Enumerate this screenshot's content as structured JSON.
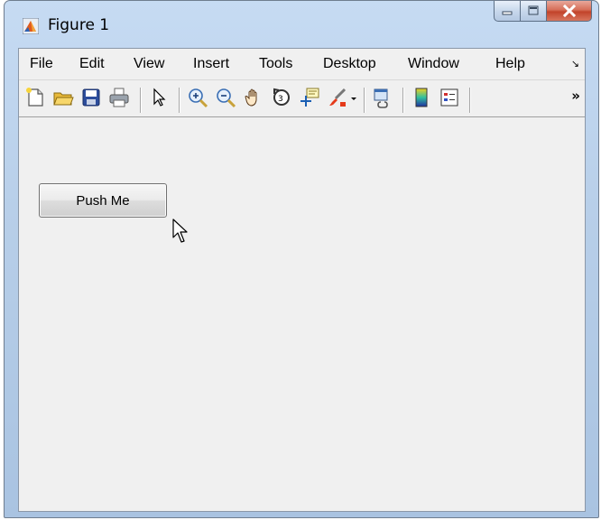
{
  "window": {
    "title": "Figure 1",
    "caption_buttons": [
      "minimize",
      "maximize",
      "close"
    ]
  },
  "menubar": {
    "items": [
      "File",
      "Edit",
      "View",
      "Insert",
      "Tools",
      "Desktop",
      "Window",
      "Help"
    ],
    "overflow_glyph": "↘"
  },
  "toolbar": {
    "more_glyph": "»",
    "icons": [
      "new-figure-icon",
      "open-file-icon",
      "save-icon",
      "print-icon",
      "select-pointer-icon",
      "zoom-in-icon",
      "zoom-out-icon",
      "pan-hand-icon",
      "rotate-3d-icon",
      "data-cursor-icon",
      "brush-icon",
      "brush-dropdown-icon",
      "link-plot-icon",
      "colorbar-icon",
      "legend-icon"
    ]
  },
  "content": {
    "push_button_label": "Push Me"
  },
  "colors": {
    "title_bar": "#b8cfe9",
    "client_bg": "#f0f0f0",
    "close_button": "#c2432a"
  }
}
